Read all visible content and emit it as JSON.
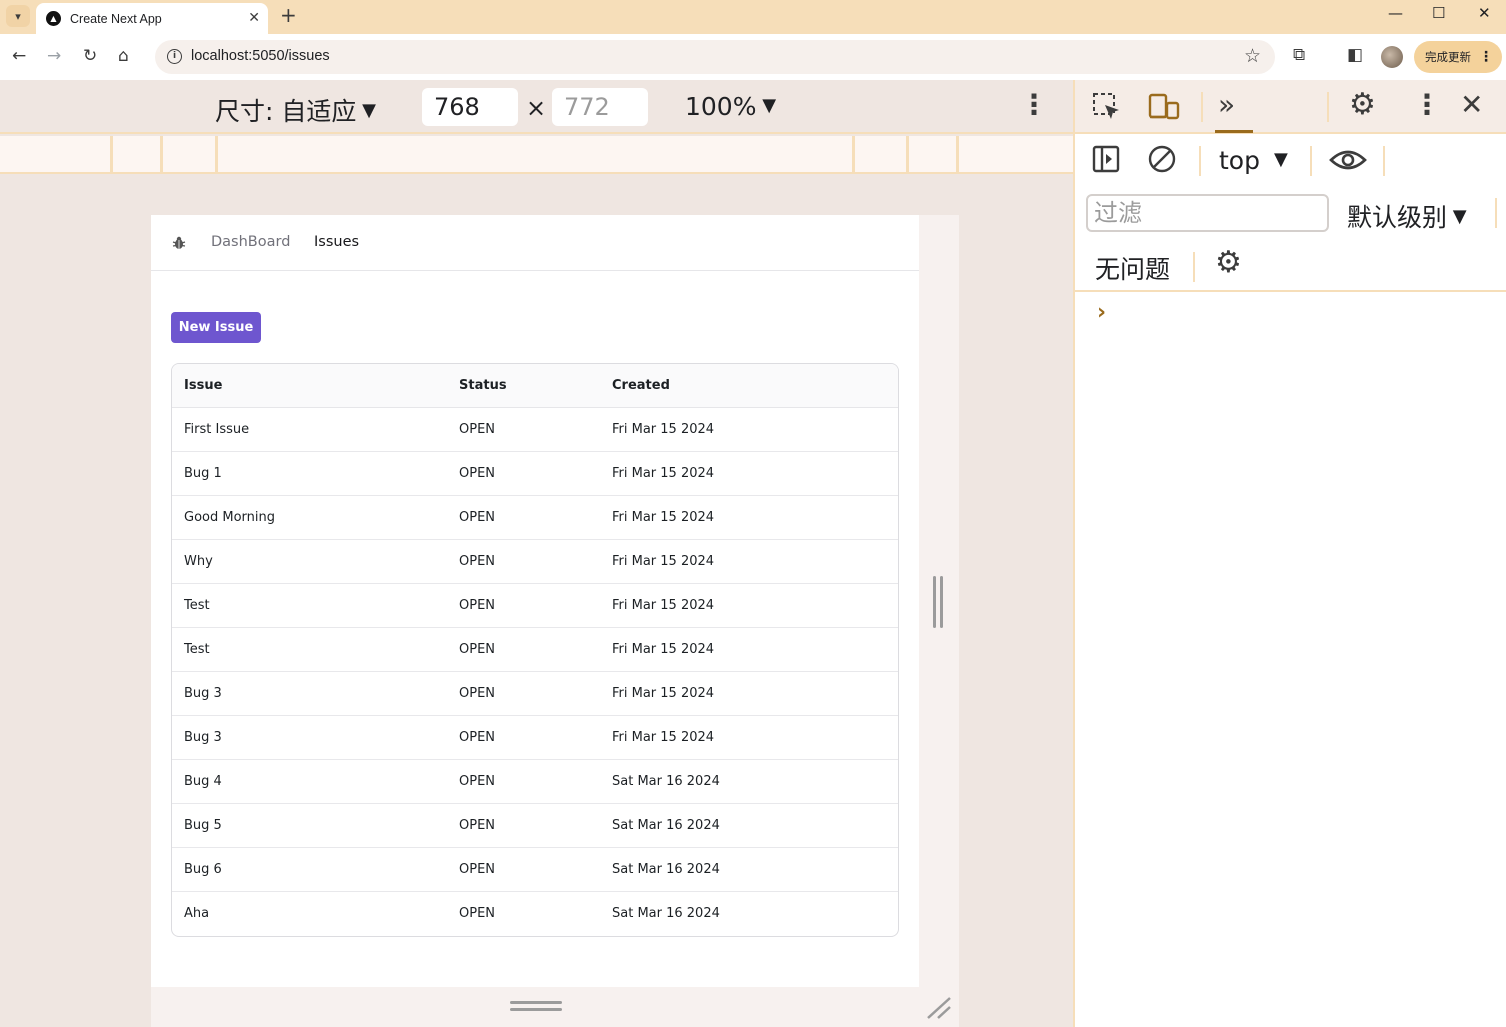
{
  "browser": {
    "tab_title": "Create Next App",
    "tab_close": "✕",
    "new_tab": "+",
    "url": "localhost:5050/issues",
    "update_label": "完成更新",
    "window_controls": {
      "minimize": "—",
      "maximize": "☐",
      "close": "✕"
    }
  },
  "device_toolbar": {
    "dimensions_label": "尺寸: 自适应",
    "width": "768",
    "height": "772",
    "times": "×",
    "zoom": "100%"
  },
  "app": {
    "nav": {
      "dashboard": "DashBoard",
      "issues": "Issues"
    },
    "new_issue_button": "New Issue",
    "table": {
      "headers": [
        "Issue",
        "Status",
        "Created"
      ],
      "rows": [
        [
          "First Issue",
          "OPEN",
          "Fri Mar 15 2024"
        ],
        [
          "Bug 1",
          "OPEN",
          "Fri Mar 15 2024"
        ],
        [
          "Good Morning",
          "OPEN",
          "Fri Mar 15 2024"
        ],
        [
          "Why",
          "OPEN",
          "Fri Mar 15 2024"
        ],
        [
          "Test",
          "OPEN",
          "Fri Mar 15 2024"
        ],
        [
          "Test",
          "OPEN",
          "Fri Mar 15 2024"
        ],
        [
          "Bug 3",
          "OPEN",
          "Fri Mar 15 2024"
        ],
        [
          "Bug 3",
          "OPEN",
          "Fri Mar 15 2024"
        ],
        [
          "Bug 4",
          "OPEN",
          "Sat Mar 16 2024"
        ],
        [
          "Bug 5",
          "OPEN",
          "Sat Mar 16 2024"
        ],
        [
          "Bug 6",
          "OPEN",
          "Sat Mar 16 2024"
        ],
        [
          "Aha",
          "OPEN",
          "Sat Mar 16 2024"
        ]
      ]
    }
  },
  "devtools": {
    "context": "top",
    "filter_placeholder": "过滤",
    "log_level": "默认级别",
    "no_issues": "无问题",
    "prompt": "›"
  },
  "colors": {
    "accent": "#6e56cf",
    "chrome_frame": "#f6deb9",
    "devtools_accent": "#9a6b1d"
  }
}
